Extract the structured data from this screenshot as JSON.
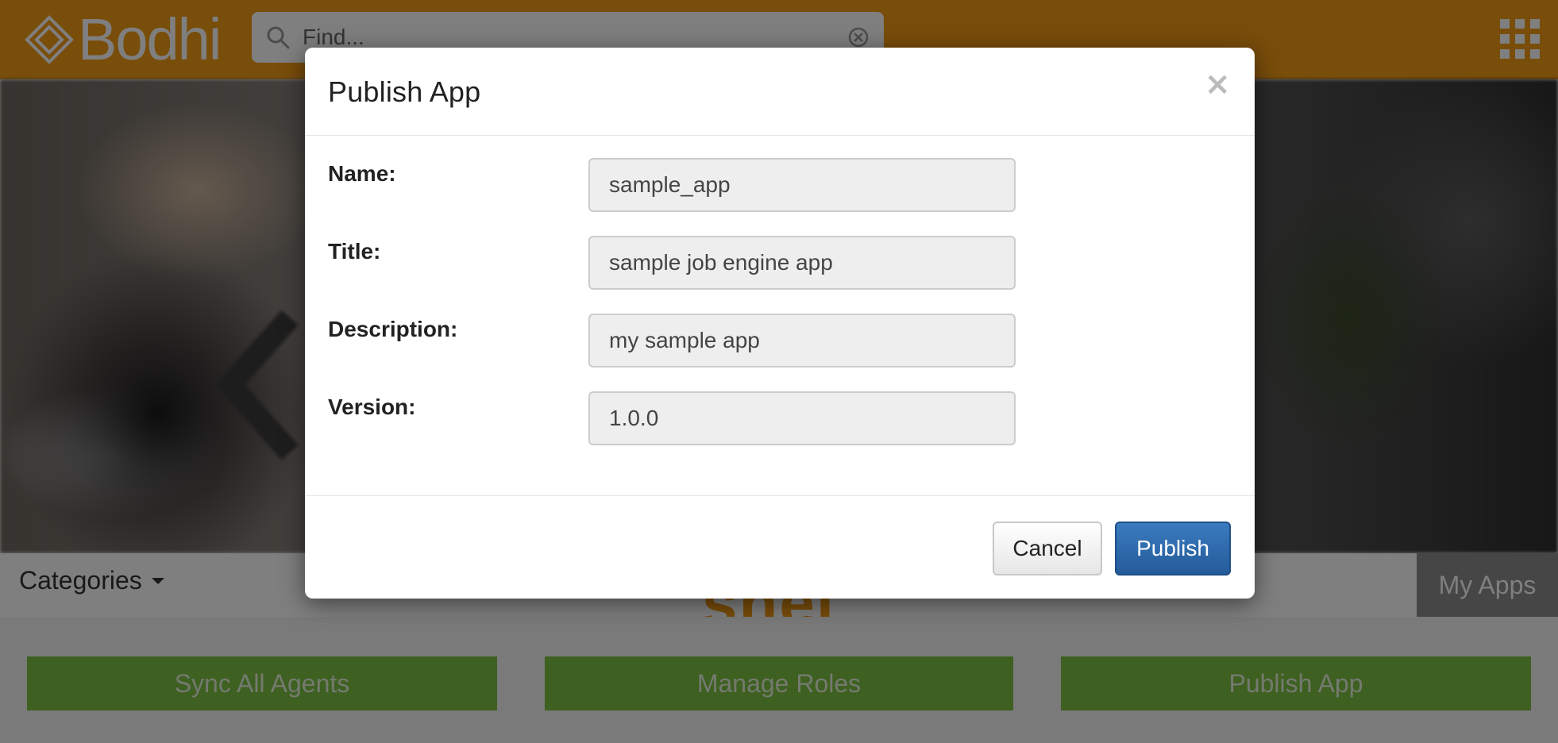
{
  "header": {
    "logo_text": "Bodhi",
    "search_placeholder": "Find...",
    "brand_color": "#f29a15"
  },
  "nav": {
    "categories_label": "Categories",
    "my_apps_label": "My Apps",
    "center_title_fragment": "shel"
  },
  "actions": {
    "sync_all_agents": "Sync All Agents",
    "manage_roles": "Manage Roles",
    "publish_app": "Publish App",
    "button_color": "#7cc143"
  },
  "modal": {
    "title": "Publish App",
    "close_symbol": "×",
    "fields": [
      {
        "label": "Name:",
        "value": "sample_app"
      },
      {
        "label": "Title:",
        "value": "sample job engine app"
      },
      {
        "label": "Description:",
        "value": "my sample app"
      },
      {
        "label": "Version:",
        "value": "1.0.0"
      }
    ],
    "cancel_label": "Cancel",
    "publish_label": "Publish",
    "primary_color": "#2d6aa8"
  }
}
